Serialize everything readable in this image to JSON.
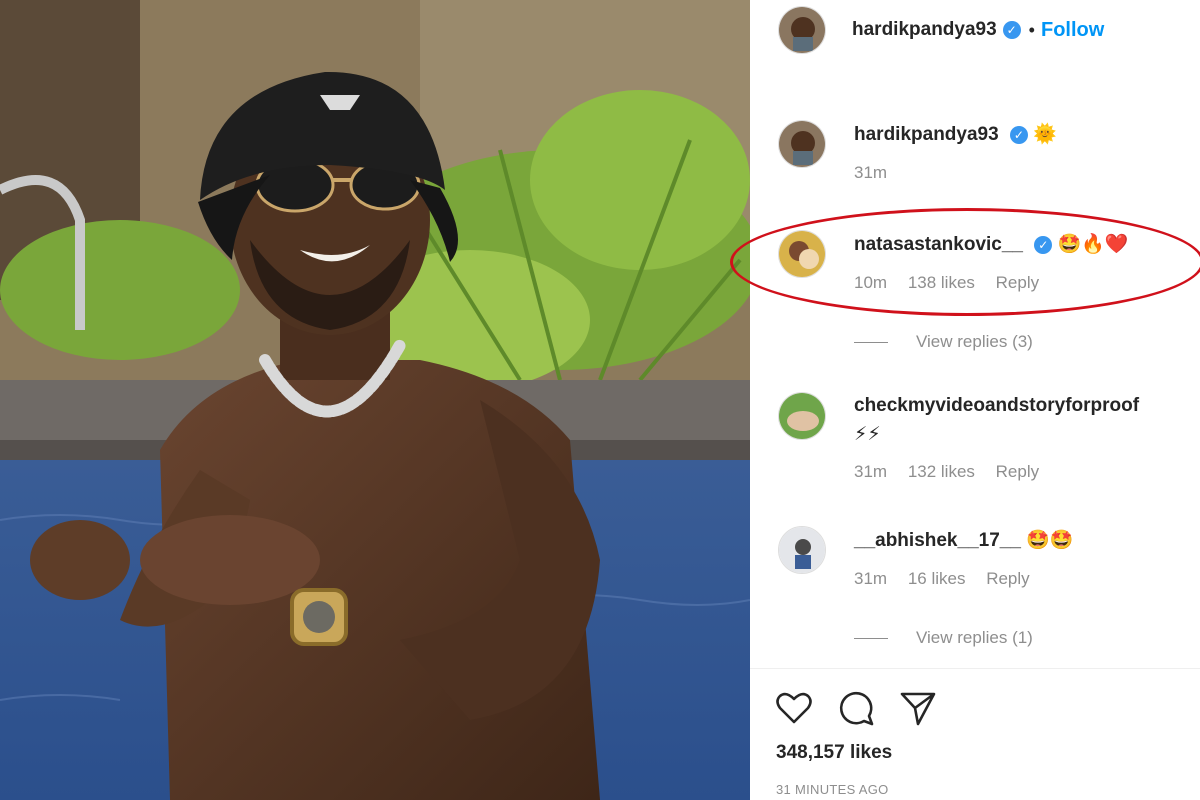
{
  "post": {
    "author": "hardikpandya93",
    "follow_label": "Follow",
    "separator": "•",
    "verified_glyph": "✓",
    "likes": "348,157 likes",
    "timestamp": "31 MINUTES AGO"
  },
  "comments": [
    {
      "username": "hardikpandya93",
      "text": "🌞",
      "time": "31m",
      "likes": "",
      "reply": "",
      "verified": true
    },
    {
      "username": "natasastankovic__",
      "text": "🤩🔥❤️",
      "time": "10m",
      "likes": "138 likes",
      "reply": "Reply",
      "verified": true,
      "view_replies": "View replies (3)"
    },
    {
      "username": "checkmyvideoandstoryforproof",
      "text": "⚡⚡",
      "time": "31m",
      "likes": "132 likes",
      "reply": "Reply",
      "verified": false
    },
    {
      "username": "__abhishek__17__",
      "text": "🤩🤩",
      "time": "31m",
      "likes": "16 likes",
      "reply": "Reply",
      "verified": false,
      "view_replies": "View replies (1)"
    }
  ],
  "icons": {
    "like": "heart-icon",
    "comment": "comment-bubble-icon",
    "share": "paper-plane-icon"
  },
  "colors": {
    "follow": "#0095f6",
    "verified": "#3897f0",
    "highlight_circle": "#d0111b",
    "muted": "#8e8e8e"
  }
}
